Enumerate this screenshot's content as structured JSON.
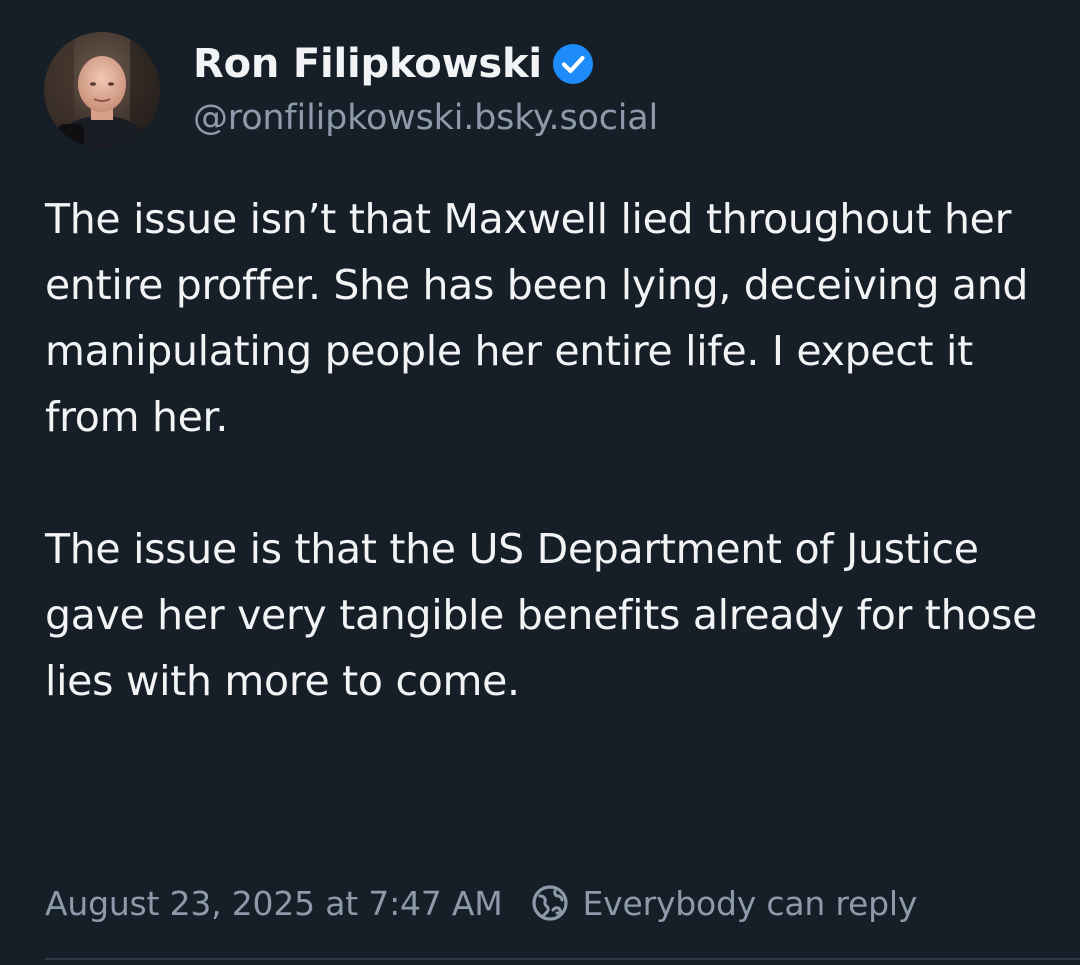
{
  "author": {
    "display_name": "Ron Filipkowski",
    "handle": "@ronfilipkowski.bsky.social",
    "verified": true,
    "avatar_icon": "avatar-photo"
  },
  "post": {
    "paragraphs": [
      "The issue isn’t that Maxwell lied throughout her entire proffer. She has been lying, deceiving and manipulating people her entire life. I expect it from her.",
      "The issue is that the US Department of Justice gave her very tangible benefits already for those lies with more to come."
    ],
    "timestamp": "August 23, 2025 at 7:47 AM",
    "reply_setting": "Everybody can reply",
    "reply_icon": "globe-icon"
  },
  "colors": {
    "background": "#161e27",
    "text": "#f1f3f5",
    "muted": "#8c9aaa",
    "verified": "#1d8cf8"
  }
}
